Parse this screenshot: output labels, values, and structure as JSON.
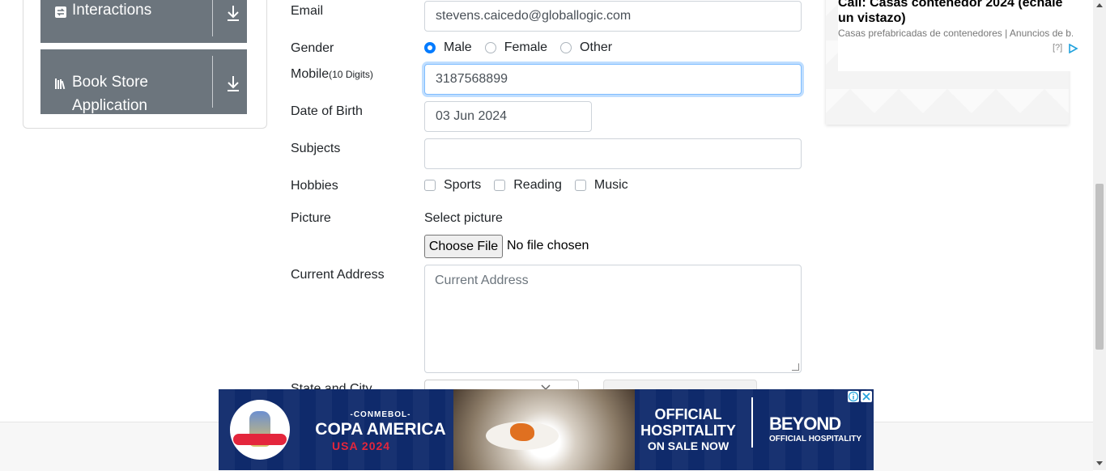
{
  "sidebar": {
    "groups": [
      {
        "label": "Interactions",
        "icon": "interactions-icon"
      },
      {
        "label": "Book Store Application",
        "icon": "book-store-icon"
      }
    ]
  },
  "form": {
    "email": {
      "label": "Email",
      "value": "stevens.caicedo@globallogic.com"
    },
    "gender": {
      "label": "Gender",
      "options": [
        "Male",
        "Female",
        "Other"
      ],
      "selected": "Male"
    },
    "mobile": {
      "label": "Mobile",
      "label_hint": "(10 Digits)",
      "value": "3187568899"
    },
    "dob": {
      "label": "Date of Birth",
      "value": "03 Jun 2024"
    },
    "subjects": {
      "label": "Subjects",
      "value": ""
    },
    "hobbies": {
      "label": "Hobbies",
      "options": [
        "Sports",
        "Reading",
        "Music"
      ]
    },
    "picture": {
      "label": "Picture",
      "prompt": "Select picture",
      "button": "Choose File",
      "status": "No file chosen"
    },
    "address": {
      "label": "Current Address",
      "placeholder": "Current Address"
    },
    "state_city": {
      "label": "State and City"
    }
  },
  "ad_card": {
    "title": "Call: Casas contenedor 2024 (échale un vistazo)",
    "description": "Casas prefabricadas de contenedores | Anuncios de b...",
    "help": "[?]"
  },
  "banner": {
    "conmebol": "-CONMEBOL-",
    "copa": "COPA AMERICA",
    "usa": "USA 2024",
    "official": "OFFICIAL HOSPITALITY",
    "sale": "ON SALE NOW",
    "beyond": "BEYOND",
    "beyond_sub": "OFFICIAL HOSPITALITY"
  },
  "colors": {
    "sidebar_group": "#6c757d",
    "accent": "#007bff",
    "banner_bg": "#0f2a6b"
  }
}
